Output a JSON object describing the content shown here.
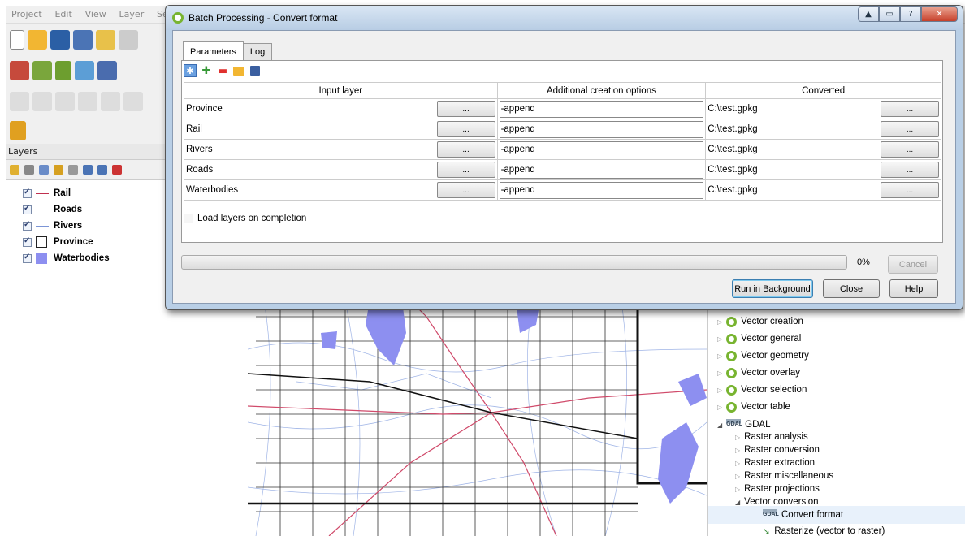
{
  "qgis": {
    "menu": [
      "Project",
      "Edit",
      "View",
      "Layer",
      "Set"
    ],
    "layers_panel_title": "Layers",
    "layers": [
      {
        "name": "Rail",
        "symbol": "line",
        "color": "#c0304f",
        "underline": true
      },
      {
        "name": "Roads",
        "symbol": "line",
        "color": "#222222",
        "underline": false
      },
      {
        "name": "Rivers",
        "symbol": "line",
        "color": "#7c95d6",
        "underline": false
      },
      {
        "name": "Province",
        "symbol": "fill",
        "color": "#ffffff",
        "underline": false
      },
      {
        "name": "Waterbodies",
        "symbol": "fill",
        "color": "#8d8ff0",
        "underline": false
      }
    ]
  },
  "processing_tree": {
    "groups": [
      {
        "label": "Vector creation"
      },
      {
        "label": "Vector general"
      },
      {
        "label": "Vector geometry"
      },
      {
        "label": "Vector overlay"
      },
      {
        "label": "Vector selection"
      },
      {
        "label": "Vector table"
      }
    ],
    "provider": "GDAL",
    "gdal_groups": [
      "Raster analysis",
      "Raster conversion",
      "Raster extraction",
      "Raster miscellaneous",
      "Raster projections"
    ],
    "expanded_group": "Vector conversion",
    "algorithms": [
      "Convert format",
      "Rasterize (vector to raster)"
    ]
  },
  "dialog": {
    "title": "Batch Processing - Convert format",
    "tabs": [
      "Parameters",
      "Log"
    ],
    "columns": [
      "Input layer",
      "Additional creation options",
      "Converted"
    ],
    "browse_label": "...",
    "rows": [
      {
        "input": "Province",
        "options": "-append",
        "output": "C:\\test.gpkg"
      },
      {
        "input": "Rail",
        "options": "-append",
        "output": "C:\\test.gpkg"
      },
      {
        "input": "Rivers",
        "options": "-append",
        "output": "C:\\test.gpkg"
      },
      {
        "input": "Roads",
        "options": "-append",
        "output": "C:\\test.gpkg"
      },
      {
        "input": "Waterbodies",
        "options": "-append",
        "output": "C:\\test.gpkg"
      }
    ],
    "load_layers_label": "Load layers on completion",
    "progress_percent": 0,
    "progress_text": "0%",
    "buttons": {
      "cancel": "Cancel",
      "run_background": "Run in Background",
      "close": "Close",
      "help": "Help"
    }
  }
}
